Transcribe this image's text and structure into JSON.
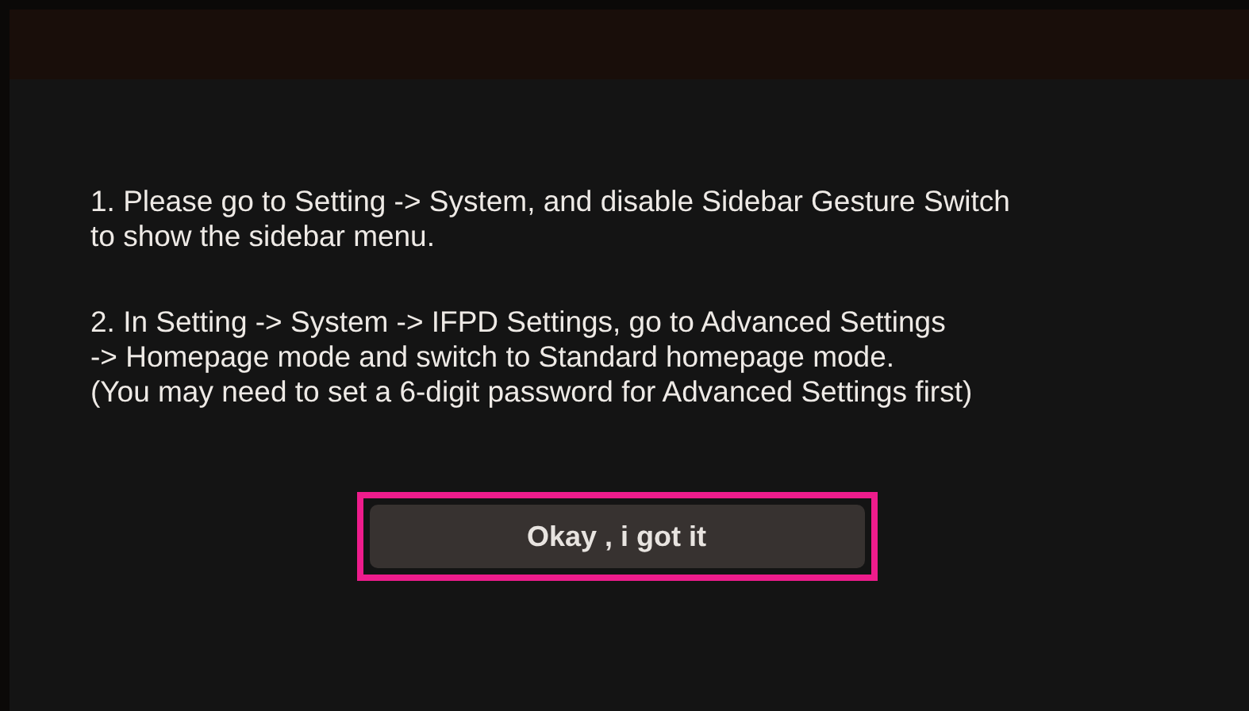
{
  "dialog": {
    "paragraphs": [
      "1. Please go to Setting -> System, and disable Sidebar Gesture Switch\nto show the sidebar menu.",
      "2. In Setting -> System -> IFPD Settings, go to Advanced Settings\n-> Homepage mode and switch to Standard homepage mode.\n(You may need to set a 6-digit password for Advanced Settings first)"
    ],
    "button": {
      "label": "Okay , i got it",
      "highlighted": true
    }
  }
}
